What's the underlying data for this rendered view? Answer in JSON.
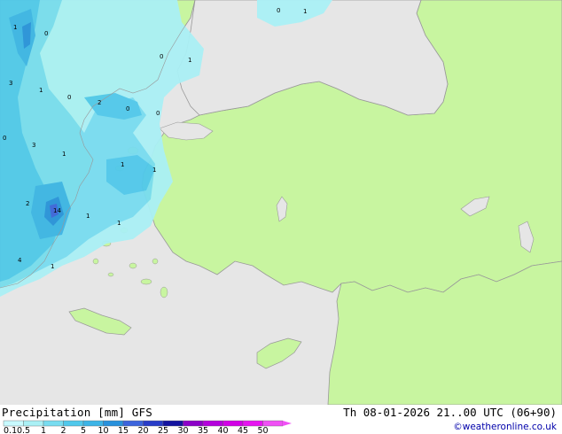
{
  "map": {
    "colors": {
      "sea": "#e6e6e6",
      "land": "#c8f5a0",
      "coast": "#999999",
      "precip_01": "#aaf0f5",
      "precip_05": "#78dcf0",
      "precip_1": "#50c8eb",
      "precip_2": "#3cb4e6",
      "precip_5": "#2891dc",
      "precip_10": "#3c64dc"
    },
    "contour_labels": [
      "0",
      "1",
      "0",
      "1",
      "3",
      "1",
      "0",
      "2",
      "0",
      "0",
      "0",
      "3",
      "1",
      "1",
      "1",
      "2",
      "14",
      "1",
      "1",
      "4",
      "1",
      "0",
      "1"
    ]
  },
  "footer": {
    "title": "Precipitation [mm]  GFS",
    "datetime": "Th 08-01-2026 21..00 UTC (06+90)",
    "credit": "©weatheronline.co.uk"
  },
  "legend": {
    "ticks": [
      "0.1",
      "0.5",
      "1",
      "2",
      "5",
      "10",
      "15",
      "20",
      "25",
      "30",
      "35",
      "40",
      "45",
      "50"
    ],
    "colors": [
      "#c8faff",
      "#aaf0f5",
      "#78dcf0",
      "#50c8eb",
      "#3cb4e6",
      "#2891dc",
      "#3c64dc",
      "#283cc8",
      "#1414a0",
      "#8c00c8",
      "#b400dc",
      "#d200e6",
      "#e614f0",
      "#f050f5"
    ]
  }
}
